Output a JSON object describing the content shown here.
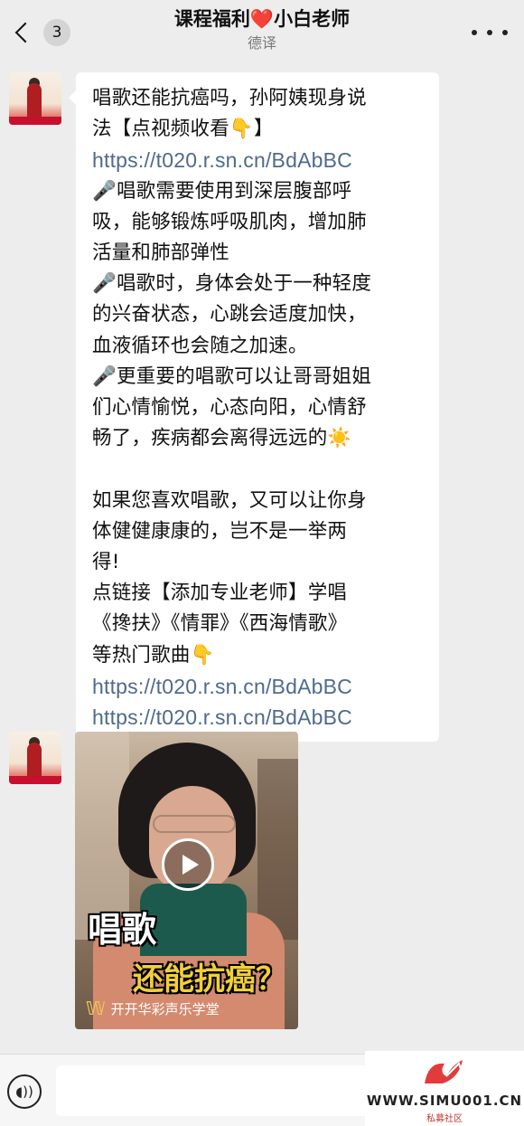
{
  "header": {
    "unread_count": "3",
    "title_part1": "课程福利",
    "title_heart": "❤️",
    "title_part2": "小白老师",
    "subtitle": "德译"
  },
  "message1": {
    "lines": [
      "唱歌还能抗癌吗，孙阿姨现身说",
      "法【点视频收看👇】",
      "https://t020.r.sn.cn/BdAbBC",
      "🎤唱歌需要使用到深层腹部呼",
      "吸，能够锻炼呼吸肌肉，增加肺",
      "活量和肺部弹性",
      "🎤唱歌时，身体会处于一种轻度",
      "的兴奋状态，心跳会适度加快，",
      "血液循环也会随之加速。",
      "🎤更重要的唱歌可以让哥哥姐姐",
      "们心情愉悦，心态向阳，心情舒",
      "畅了，疾病都会离得远远的☀️",
      "",
      "如果您喜欢唱歌，又可以让你身",
      "体健健康康的，岂不是一举两",
      "得!",
      "点链接【添加专业老师】学唱",
      "《搀扶》《情罪》《西海情歌》",
      "等热门歌曲👇",
      "https://t020.r.sn.cn/BdAbBC",
      "https://t020.r.sn.cn/BdAbBC"
    ]
  },
  "video": {
    "caption_line1": "唱歌",
    "caption_line2": "还能抗癌？",
    "channel_icon": "𝕎",
    "channel_name": "开开华彩声乐学堂"
  },
  "watermark": {
    "text": "WWW.SIMU001.CN",
    "sub": "私募社区"
  },
  "colors": {
    "link": "#506a8c",
    "background": "#ededed",
    "bubble": "#ffffff"
  }
}
